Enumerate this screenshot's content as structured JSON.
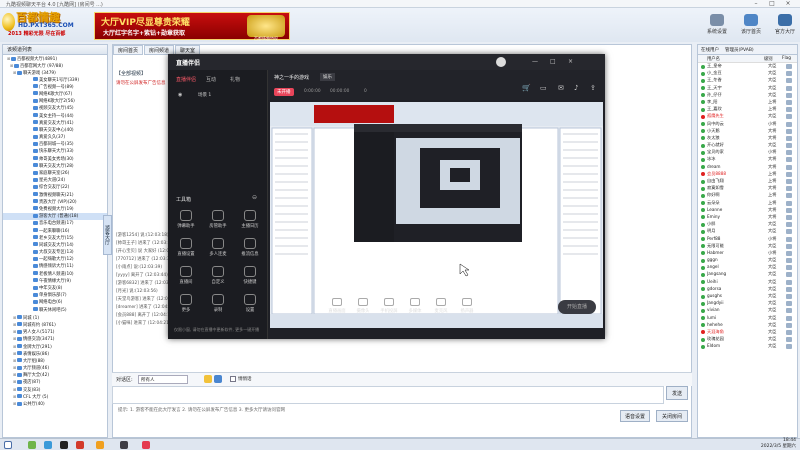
{
  "window": {
    "title": "九酷视频聊天平台 4.0 [九酷网] (房间号 ...)"
  },
  "banner": {
    "brand": "百都情趣",
    "url": "HD.PXT365.COM",
    "slogan": "2013 精彩无限 尽在百都",
    "vip_line1": "大厅VIP尽显尊贵荣耀",
    "vip_line2": "大厅红字名字+紫钻+勋章获取",
    "vip_seal_text": "百都情趣特权",
    "top_buttons": [
      {
        "label": "系统设置",
        "icon": "gear-icon",
        "color": "#7a8ea8"
      },
      {
        "label": "该厅首页",
        "icon": "home-icon",
        "color": "#4f86c6"
      },
      {
        "label": "官方大厅",
        "icon": "monitor-icon",
        "color": "#3b6ea8"
      }
    ]
  },
  "left": {
    "header": "该频道列表",
    "side_tab": "游客大厅",
    "items": [
      "百都视频大厅(4891)",
      "百都官网大厅 (97/88)",
      "聊天游戏 (3479)",
      "美女聊天1号厅(339)",
      "广告视频一号(89)",
      "网络K歌大厅(67)",
      "网络K歌大厅2(56)",
      "视频交友大厅(45)",
      "美女主持一号(44)",
      "真爱交友大厅(41)",
      "聊天交友中心(40)",
      "真爱久久(37)",
      "百都同城一号(35)",
      "快乐聊天大厅(33)",
      "帅哥美女秀场(30)",
      "聊天交友大厅(28)",
      "家庭聊天室(26)",
      "星光大道(24)",
      "综合交友厅(22)",
      "激情视频聊天(21)",
      "贵族大厅 (VIP)(20)",
      "免费视频大厅(19)",
      "游客大厅 (普通)(18)",
      "音乐电台频道(17)",
      "一起来聊聊(16)",
      "老乡交友大厅(15)",
      "同城交友大厅(14)",
      "大叔交友专区(13)",
      "一起嗨歌大厅(12)",
      "情感倾诉大厅(11)",
      "老板情人频道(10)",
      "午夜情缘大厅(9)",
      "中年交友(8)",
      "单身俱乐部(7)",
      "网络电台(6)",
      "聊天休闲吧(5)",
      "同城 (1)",
      "同城有约 (8761)",
      "男人女人(5171)",
      "情感交流(3471)",
      "金牌大厅(291)",
      "表情娱乐(86)",
      "大厅组(88)",
      "大厅频道(46)",
      "舞厅大全(42)",
      "夜店(87)",
      "交友(83)",
      "CFL 大厅 (5)",
      "公共厅(40)"
    ]
  },
  "room": {
    "tabs": [
      "房间首页",
      "房间频道",
      "聊天室"
    ],
    "caption": "【全部视频】",
    "warning": "请勿在公屏发布广告信息",
    "messages": [
      "[游客1254] 说:(12:03:18)",
      "[帅哥王子] 进来了 (12:03:20)",
      "[开心宝贝] 说 大家好 (12:03:25)",
      "[770712] 进来了 (12:03:31)",
      "[小雨点] 说:(12:03:39)",
      "[yyyy] 离开了 (12:03:44)",
      "[游客6832] 进来了 (12:03:50)",
      "[月光] 说:(12:03:56)",
      "[天堂鸟游客] 进来了 (12:04:02)",
      "[dreamer] 进来了 (12:04:09)",
      "[会员888] 离开了 (12:04:15)",
      "[小猫咪] 进来了 (12:04:21)"
    ],
    "input_label": "对话区:",
    "input_select": "所有人",
    "checkbox_label": "悄悄话",
    "send_label": "发送",
    "notice": "提示: 1. 游客不能在此大厅发言  2. 请勿在公屏发布广告信息  3. 更多大厅请访问官网",
    "btn_setting": "语音设置",
    "btn_close": "关闭房间"
  },
  "right": {
    "tabs": [
      "在线用户",
      "管理员(PVAB)"
    ],
    "col_user": "用户名",
    "col_level": "级别",
    "col_flag": "Flag",
    "users": [
      {
        "name": "王_皇帝",
        "level": "大臣",
        "color": "#39a84a"
      },
      {
        "name": "小_金豆",
        "level": "大臣",
        "color": "#39a84a"
      },
      {
        "name": "王_冬香",
        "level": "大臣",
        "color": "#39a84a"
      },
      {
        "name": "王_天宇",
        "level": "大臣",
        "color": "#39a84a"
      },
      {
        "name": "孙_仔仔",
        "level": "大臣",
        "color": "#39a84a"
      },
      {
        "name": "李_阳",
        "level": "上将",
        "color": "#39a84a"
      },
      {
        "name": "王_嘉欣",
        "level": "上将",
        "color": "#39a84a"
      },
      {
        "name": "孤鹰先生",
        "level": "大臣",
        "color": "#e02020"
      },
      {
        "name": "风中的云",
        "level": "小将",
        "color": "#39a84a"
      },
      {
        "name": "小天鹅",
        "level": "大将",
        "color": "#39a84a"
      },
      {
        "name": "灰太狼",
        "level": "大将",
        "color": "#39a84a"
      },
      {
        "name": "开心就好",
        "level": "大臣",
        "color": "#39a84a"
      },
      {
        "name": "宝贝的家",
        "level": "小将",
        "color": "#39a84a"
      },
      {
        "name": "冰冰",
        "level": "大将",
        "color": "#39a84a"
      },
      {
        "name": "dream",
        "level": "大将",
        "color": "#39a84a"
      },
      {
        "name": "会员8888",
        "level": "上将",
        "color": "#e02020"
      },
      {
        "name": "自由飞翔",
        "level": "上将",
        "color": "#39a84a"
      },
      {
        "name": "寂寞如雪",
        "level": "大将",
        "color": "#39a84a"
      },
      {
        "name": "你好啊",
        "level": "上将",
        "color": "#39a84a"
      },
      {
        "name": "云朵朵",
        "level": "上将",
        "color": "#39a84a"
      },
      {
        "name": "Leanne",
        "level": "大将",
        "color": "#39a84a"
      },
      {
        "name": "Eminy",
        "level": "大将",
        "color": "#39a84a"
      },
      {
        "name": "小胖",
        "level": "大臣",
        "color": "#39a84a"
      },
      {
        "name": "明月",
        "level": "大臣",
        "color": "#39a84a"
      },
      {
        "name": "Perf88",
        "level": "小将",
        "color": "#39a84a"
      },
      {
        "name": "无限可能",
        "level": "大臣",
        "color": "#39a84a"
      },
      {
        "name": "Habmer",
        "level": "小将",
        "color": "#39a84a"
      },
      {
        "name": "gggn",
        "level": "大臣",
        "color": "#39a84a"
      },
      {
        "name": "angel",
        "level": "大臣",
        "color": "#39a84a"
      },
      {
        "name": "Jangsang",
        "level": "大臣",
        "color": "#39a84a"
      },
      {
        "name": "Ueihi",
        "level": "大臣",
        "color": "#39a84a"
      },
      {
        "name": "gdorsa",
        "level": "大臣",
        "color": "#39a84a"
      },
      {
        "name": "gusghs",
        "level": "大臣",
        "color": "#39a84a"
      },
      {
        "name": "Jangdyii",
        "level": "大臣",
        "color": "#39a84a"
      },
      {
        "name": "vivian",
        "level": "大臣",
        "color": "#39a84a"
      },
      {
        "name": "lumi",
        "level": "大臣",
        "color": "#39a84a"
      },
      {
        "name": "hehehe",
        "level": "大臣",
        "color": "#39a84a"
      },
      {
        "name": "天涯海角",
        "level": "大臣",
        "color": "#e02020"
      },
      {
        "name": "玫瑰花园",
        "level": "大臣",
        "color": "#39a84a"
      },
      {
        "name": "Eldom",
        "level": "大臣",
        "color": "#39a84a"
      }
    ]
  },
  "obs": {
    "logo": "直播伴侣",
    "tabs": [
      "直播伴侣",
      "互动",
      "礼物"
    ],
    "scene_title": "神之一手的游戏",
    "scene_tag": "娱乐",
    "live_state": "未开播",
    "stats": [
      "0:00:00",
      "00:00:00",
      "0"
    ],
    "scene_label": "场景 1",
    "tools_title": "工具箱",
    "tools": [
      "弹幕助手",
      "房管助手",
      "主播日历",
      "直播设置",
      "多人连麦",
      "推流信息",
      "直播间",
      "自定义",
      "快捷键",
      "更多",
      "录制",
      "设置"
    ],
    "controls": [
      "直播画面",
      "摄像头",
      "手机投屏",
      "多媒体",
      "麦克风",
      "扬声器"
    ],
    "start_button": "开始直播",
    "footer_tip": "仅限小窗, 请勿在直播中更新软件, 更多一键开播"
  },
  "taskbar": {
    "time": "18:44",
    "date": "2022/3/5 星期六"
  }
}
